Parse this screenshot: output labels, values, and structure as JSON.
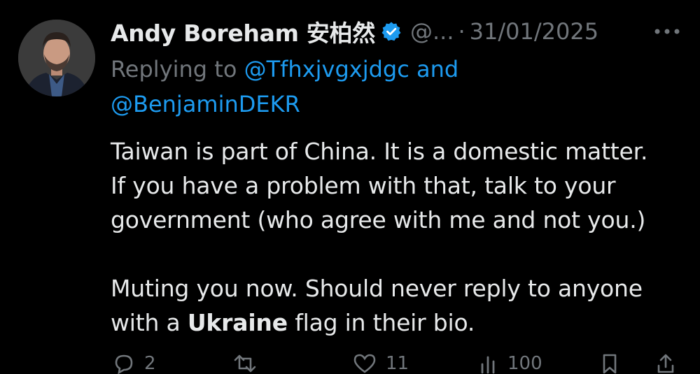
{
  "tweet": {
    "author": {
      "display_name": "Andy Boreham 安柏然",
      "handle": "@...",
      "verified": true,
      "avatar_icon": "profile-photo"
    },
    "separator": "·",
    "date": "31/01/2025",
    "more_icon": "more-horizontal-icon",
    "replying": {
      "prefix": "Replying to ",
      "mention_1": "@Tfhxjvgxjdgc",
      "conjunction": " and",
      "mention_2": "@BenjaminDEKR"
    },
    "body": {
      "line_1": "Taiwan is part of China. It is a domestic matter.",
      "line_2": "If you have a problem with that, talk to your",
      "line_3": "government (who agree with me and not you.)",
      "line_4": "Muting you now. Should never reply to anyone",
      "line_5_pre": "with a ",
      "line_5_bold": "Ukraine",
      "line_5_post": " flag in their bio."
    },
    "actions": {
      "reply_count": "2",
      "repost_count": "",
      "like_count": "11",
      "views_count": "100"
    }
  },
  "colors": {
    "background": "#000000",
    "primary_text": "#e7e9ea",
    "secondary_text": "#71767b",
    "link": "#1d9bf0",
    "verified": "#1d9bf0"
  }
}
